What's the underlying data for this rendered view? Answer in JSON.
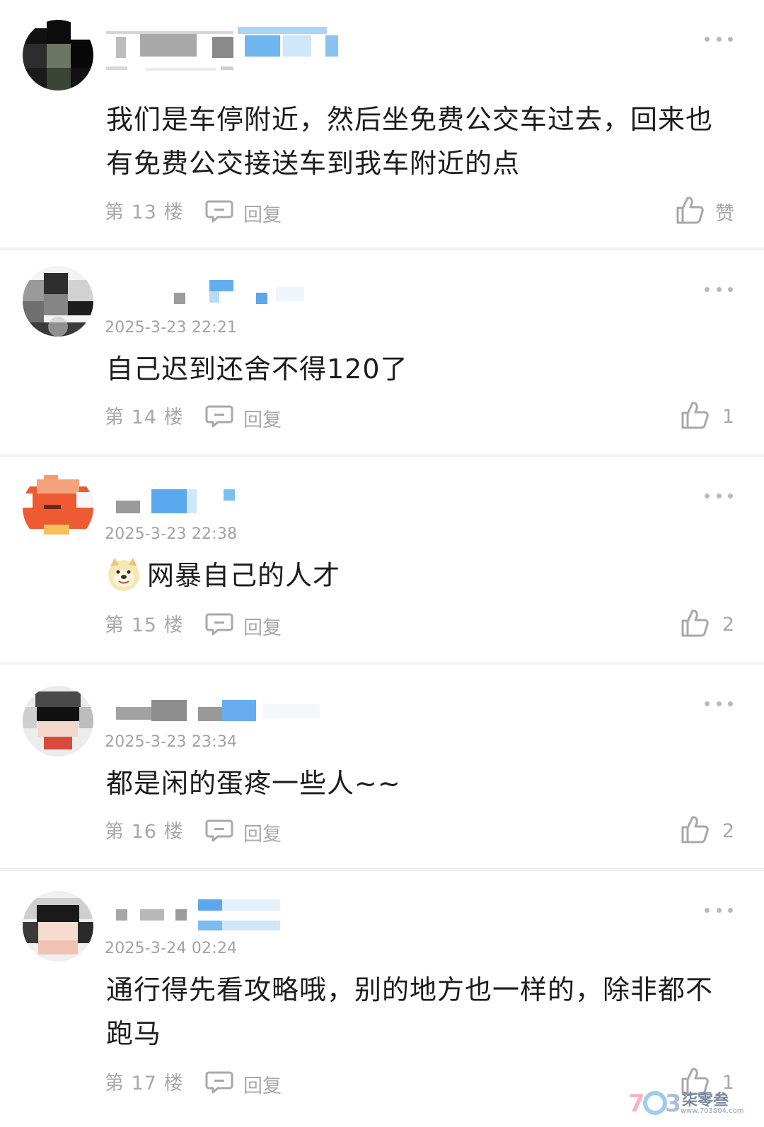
{
  "comments": [
    {
      "time": "",
      "text": "我们是车停附近，然后坐免费公交车过去，回来也有免费公交接送车到我车附近的点",
      "floor": "第 13 楼",
      "reply": "回复",
      "likes": "赞"
    },
    {
      "time": "2025-3-23 22:21",
      "text": "自己迟到还舍不得120了",
      "floor": "第 14 楼",
      "reply": "回复",
      "likes": "1"
    },
    {
      "time": "2025-3-23 22:38",
      "text": "网暴自己的人才",
      "floor": "第 15 楼",
      "reply": "回复",
      "likes": "2"
    },
    {
      "time": "2025-3-23 23:34",
      "text": "都是闲的蛋疼一些人~~",
      "floor": "第 16 楼",
      "reply": "回复",
      "likes": "2"
    },
    {
      "time": "2025-3-24 02:24",
      "text": "通行得先看攻略哦，别的地方也一样的，除非都不跑马",
      "floor": "第 17 楼",
      "reply": "回复",
      "likes": "1"
    }
  ],
  "icons": {
    "more": "more-icon",
    "reply": "comment-bubble-icon",
    "like": "thumbs-up-icon",
    "emoji": "doge-emoji-icon"
  },
  "watermark": {
    "text": "柒零叁",
    "url": "www.703804.com"
  },
  "colors": {
    "meta_text": "#a8a8a8",
    "body_text": "#1c1c1c",
    "username_blur_gray": "#b4b4b4",
    "username_blur_blue": "#79bdf2"
  }
}
